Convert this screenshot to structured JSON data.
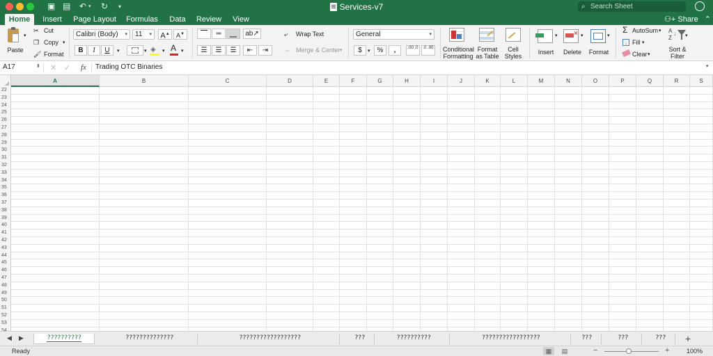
{
  "window": {
    "title": "Services-v7",
    "search_placeholder": "Search Sheet",
    "share_label": "Share"
  },
  "ribbon_tabs": [
    "Home",
    "Insert",
    "Page Layout",
    "Formulas",
    "Data",
    "Review",
    "View"
  ],
  "ribbon": {
    "paste": "Paste",
    "cut": "Cut",
    "copy": "Copy",
    "format_painter": "Format",
    "font_name": "Calibri (Body)",
    "font_size": "11",
    "grow_font": "A",
    "shrink_font": "A",
    "bold": "B",
    "italic": "I",
    "underline": "U",
    "font_color_letter": "A",
    "wrap_text": "Wrap Text",
    "merge_center": "Merge & Center",
    "number_format": "General",
    "currency": "$",
    "percent": "%",
    "comma": ",",
    "increase_decimal": ".00 .0",
    "decrease_decimal": ".0 .00",
    "conditional_formatting": [
      "Conditional",
      "Formatting"
    ],
    "format_as_table": [
      "Format",
      "as Table"
    ],
    "cell_styles": [
      "Cell",
      "Styles"
    ],
    "insert": "Insert",
    "delete": "Delete",
    "format": "Format",
    "autosum": "AutoSum",
    "fill": "Fill",
    "clear": "Clear",
    "sort_filter": [
      "Sort &",
      "Filter"
    ]
  },
  "formula_bar": {
    "name_box": "A17",
    "fx": "fx",
    "content": "Trading OTC Binaries"
  },
  "columns": [
    "A",
    "B",
    "C",
    "D",
    "E",
    "F",
    "G",
    "H",
    "I",
    "J",
    "K",
    "L",
    "M",
    "N",
    "O",
    "P",
    "Q",
    "R",
    "S"
  ],
  "selected_column": "A",
  "rows": [
    "22",
    "23",
    "24",
    "25",
    "26",
    "27",
    "28",
    "29",
    "30",
    "31",
    "32",
    "33",
    "34",
    "35",
    "36",
    "37",
    "38",
    "39",
    "40",
    "41",
    "42",
    "43",
    "44",
    "45",
    "46",
    "47",
    "48",
    "49",
    "50",
    "51",
    "52",
    "53",
    "54"
  ],
  "sheet_tabs": [
    "??????????",
    "??????????????",
    "??????????????????",
    "???",
    "??????????",
    "?????????????????",
    "???",
    "???",
    "???"
  ],
  "status": {
    "text": "Ready",
    "zoom": "100%",
    "zoom_level_percent": 100
  },
  "colors": {
    "accent": "#217346",
    "ribbon_bg": "#f3f3f3",
    "highlight_yellow": "#ffff00",
    "font_red": "#e02020"
  }
}
